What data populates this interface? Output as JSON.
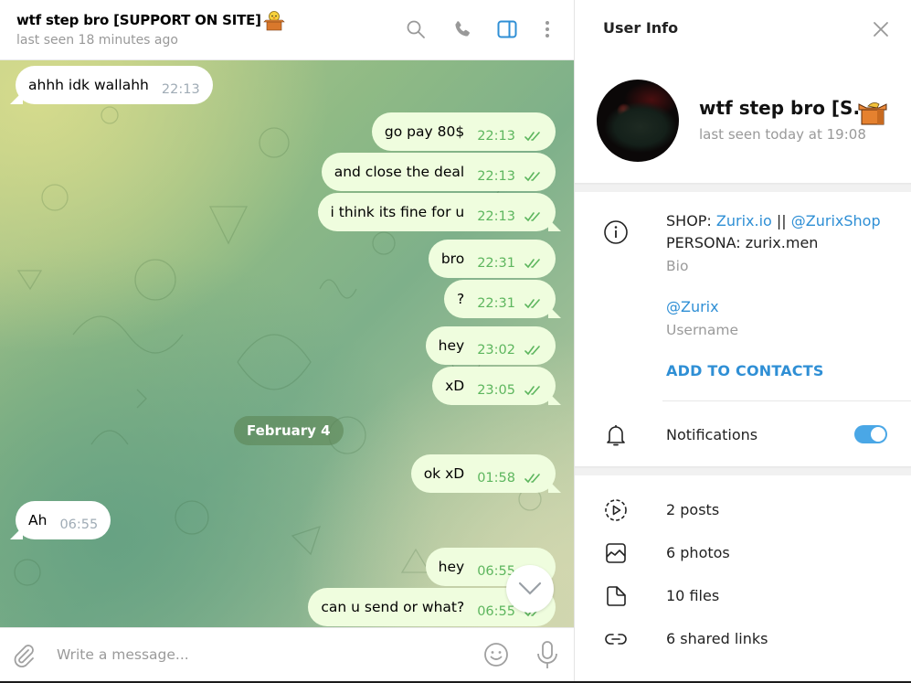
{
  "chat": {
    "title": "wtf step bro [SUPPORT ON SITE]",
    "title_emoji": "duck-in-box-emoji",
    "status": "last seen 18 minutes ago",
    "header_icons": [
      "search-icon",
      "phone-icon",
      "sidebar-toggle-icon",
      "more-vertical-icon"
    ],
    "messages": [
      {
        "dir": "in",
        "text": "ahhh idk wallahh",
        "time": "22:13"
      },
      {
        "dir": "out",
        "text": "go pay 80$",
        "time": "22:13",
        "read": true
      },
      {
        "dir": "out",
        "text": "and close the deal",
        "time": "22:13",
        "read": true
      },
      {
        "dir": "out",
        "text": "i think its fine for u",
        "time": "22:13",
        "read": true
      },
      {
        "dir": "out",
        "text": "bro",
        "time": "22:31",
        "read": true
      },
      {
        "dir": "out",
        "text": "?",
        "time": "22:31",
        "read": true
      },
      {
        "dir": "out",
        "text": "hey",
        "time": "23:02",
        "read": true
      },
      {
        "dir": "out",
        "text": "xD",
        "time": "23:05",
        "read": true
      },
      {
        "dir": "out",
        "text": "ok xD",
        "time": "01:58",
        "read": true
      },
      {
        "dir": "in",
        "text": "Ah",
        "time": "06:55"
      },
      {
        "dir": "out",
        "text": "hey",
        "time": "06:55",
        "read": true
      },
      {
        "dir": "out",
        "text": "can u send or what?",
        "time": "06:55",
        "read": true
      }
    ],
    "date_separator": "February 4",
    "composer": {
      "placeholder": "Write a message...",
      "value": ""
    }
  },
  "user_info": {
    "title": "User Info",
    "name": "wtf step bro [S...",
    "status": "last seen today at 19:08",
    "bio": {
      "line1_prefix": "SHOP: ",
      "link1": "Zurix.io",
      "separator": " || ",
      "link2": "@ZurixShop",
      "line2": "PERSONA: zurix.men",
      "label": "Bio"
    },
    "username": {
      "value": "@Zurix",
      "label": "Username"
    },
    "add_contacts": "ADD TO CONTACTS",
    "notifications": {
      "label": "Notifications",
      "enabled": true
    },
    "media": [
      {
        "icon": "posts-icon",
        "label": "2 posts"
      },
      {
        "icon": "photo-icon",
        "label": "6 photos"
      },
      {
        "icon": "file-icon",
        "label": "10 files"
      },
      {
        "icon": "link-icon",
        "label": "6 shared links"
      }
    ]
  },
  "colors": {
    "accent": "#2f8fd5",
    "outgoing_bubble": "#effdde",
    "outgoing_time": "#5db65e",
    "incoming_time": "#a0acb6",
    "toggle_on": "#4aa7e6"
  }
}
